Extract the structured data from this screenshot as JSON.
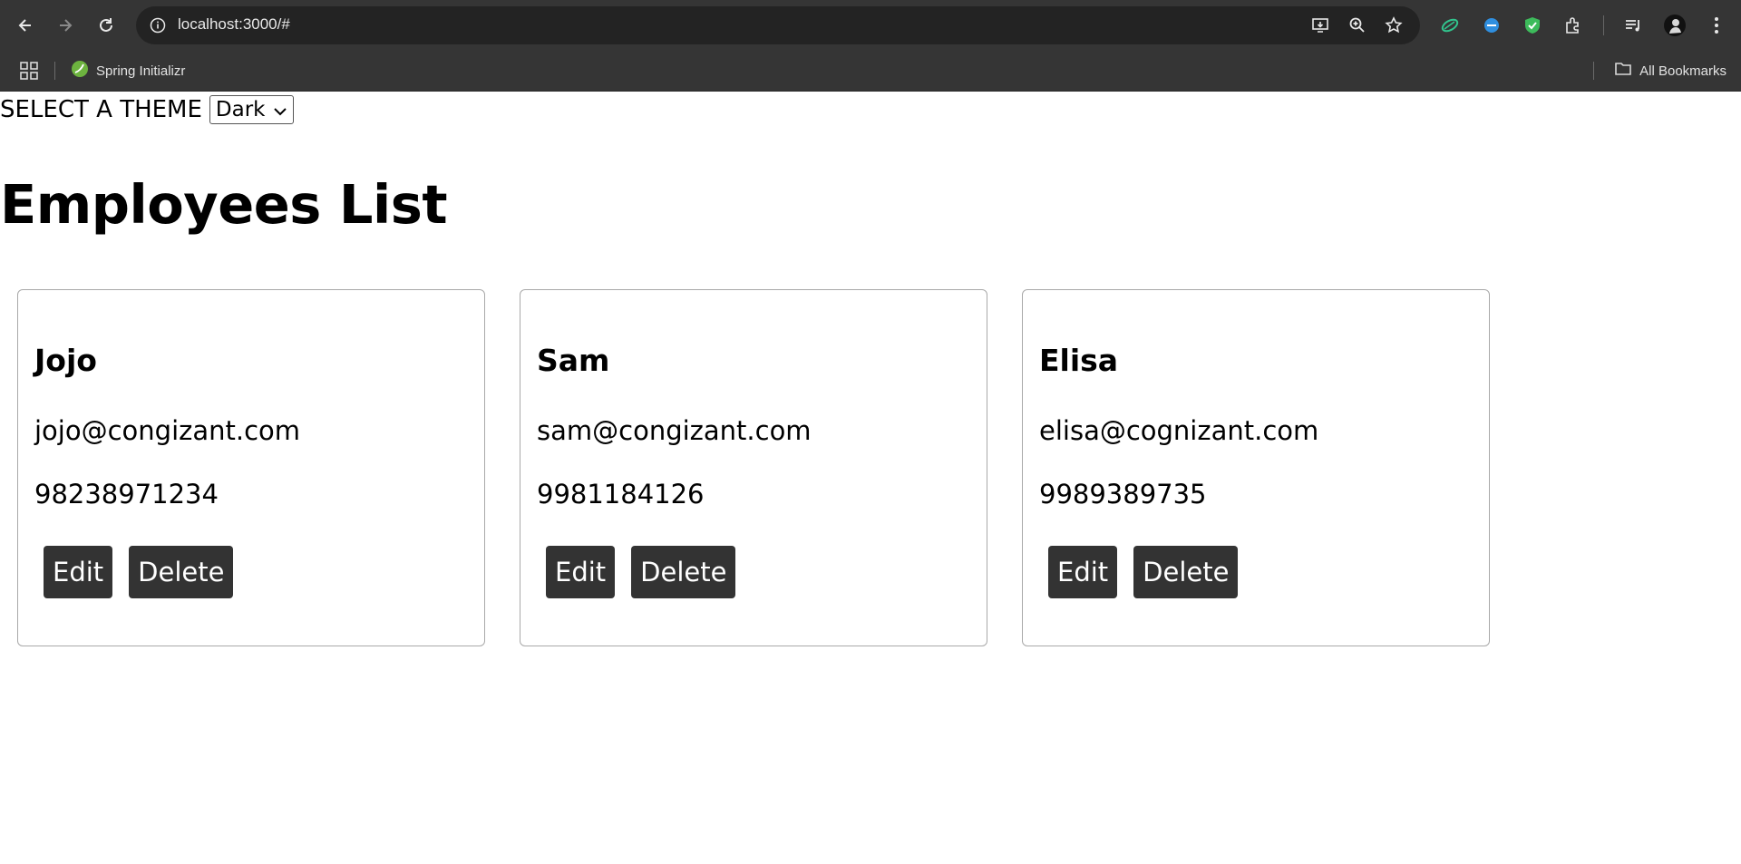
{
  "browser": {
    "url": "localhost:3000/#",
    "bookmarks": [
      {
        "label": "Spring Initializr",
        "icon": "spring-leaf-icon"
      }
    ],
    "all_bookmarks_label": "All Bookmarks"
  },
  "page": {
    "theme_label": "SELECT A THEME",
    "theme_selected": "Dark",
    "title": "Employees List",
    "employees": [
      {
        "name": "Jojo",
        "email": "jojo@congizant.com",
        "phone": "98238971234",
        "edit_label": "Edit",
        "delete_label": "Delete"
      },
      {
        "name": "Sam",
        "email": "sam@congizant.com",
        "phone": "9981184126",
        "edit_label": "Edit",
        "delete_label": "Delete"
      },
      {
        "name": "Elisa",
        "email": "elisa@cognizant.com",
        "phone": "9989389735",
        "edit_label": "Edit",
        "delete_label": "Delete"
      }
    ]
  },
  "colors": {
    "chrome_bg": "#353535",
    "omnibox_bg": "#232323",
    "button_bg": "#333333",
    "card_border": "#a9a9a9"
  }
}
